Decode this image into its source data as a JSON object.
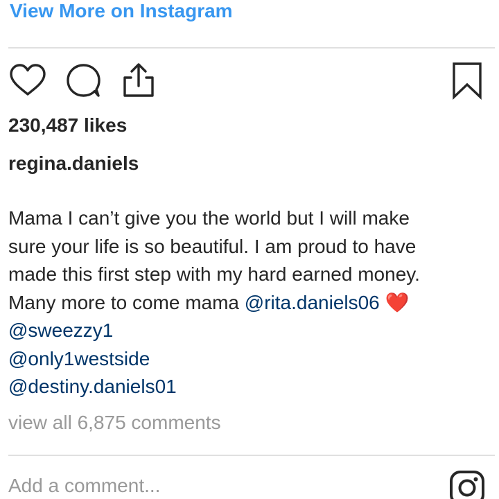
{
  "header": {
    "view_more_label": "View More on Instagram"
  },
  "actions": {
    "like_icon": "heart-outline-icon",
    "comment_icon": "speech-bubble-icon",
    "share_icon": "share-upload-icon",
    "save_icon": "bookmark-icon"
  },
  "post": {
    "likes": "230,487 likes",
    "username": "regina.daniels",
    "caption": {
      "line1": "Mama I can’t give you the world but I will make",
      "line2": "sure your life is so beautiful. I am proud to have",
      "line3": "made this first step with my hard earned money.",
      "line4_prefix": "Many more to come mama ",
      "heart": "❤️"
    },
    "mentions": [
      "@rita.daniels06",
      "@sweezzy1",
      "@only1westside",
      "@destiny.daniels01"
    ]
  },
  "comments": {
    "view_all_label": "view all 6,875 comments",
    "add_placeholder": "Add a comment..."
  },
  "colors": {
    "link_blue": "#3897f0",
    "mention_blue": "#003569",
    "muted_gray": "#999999",
    "heart_red": "#e0202c"
  }
}
